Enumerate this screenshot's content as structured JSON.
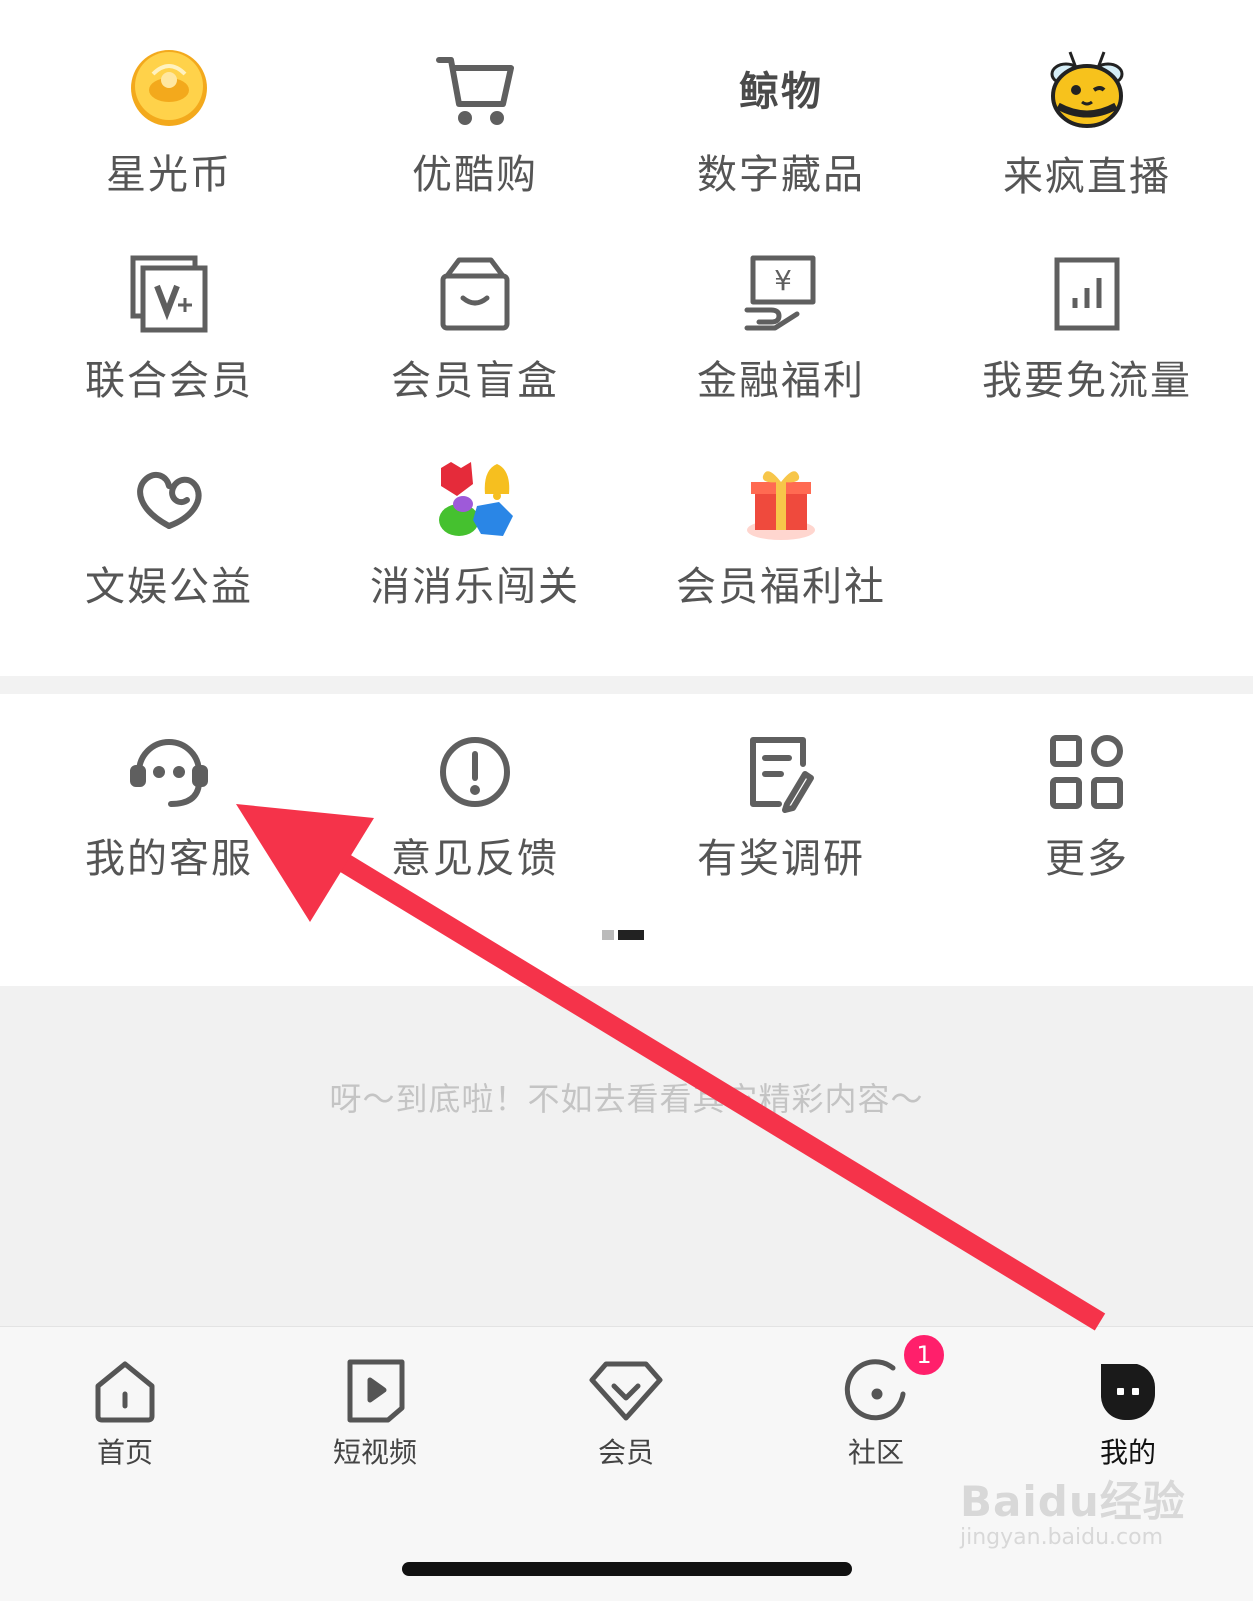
{
  "services": [
    {
      "label": "星光币",
      "icon": "star-coin-icon"
    },
    {
      "label": "优酷购",
      "icon": "cart-icon"
    },
    {
      "label": "数字藏品",
      "icon": "digital-collectibles-icon"
    },
    {
      "label": "来疯直播",
      "icon": "bee-icon"
    },
    {
      "label": "联合会员",
      "icon": "joint-membership-icon"
    },
    {
      "label": "会员盲盒",
      "icon": "blind-box-icon"
    },
    {
      "label": "金融福利",
      "icon": "finance-icon"
    },
    {
      "label": "我要免流量",
      "icon": "free-data-icon"
    },
    {
      "label": "文娱公益",
      "icon": "charity-heart-icon"
    },
    {
      "label": "消消乐闯关",
      "icon": "match-game-icon"
    },
    {
      "label": "会员福利社",
      "icon": "gift-box-icon"
    }
  ],
  "digital_logo_text": "鲸物",
  "tools": [
    {
      "label": "我的客服",
      "icon": "customer-service-icon"
    },
    {
      "label": "意见反馈",
      "icon": "feedback-icon"
    },
    {
      "label": "有奖调研",
      "icon": "survey-icon"
    },
    {
      "label": "更多",
      "icon": "more-grid-icon"
    }
  ],
  "pager": {
    "pages": 2,
    "active": 2
  },
  "end_message": "呀～到底啦！不如去看看其它精彩内容～",
  "tabbar": {
    "items": [
      {
        "label": "首页",
        "icon": "home-icon"
      },
      {
        "label": "短视频",
        "icon": "short-video-icon"
      },
      {
        "label": "会员",
        "icon": "vip-diamond-icon"
      },
      {
        "label": "社区",
        "icon": "community-icon"
      },
      {
        "label": "我的",
        "icon": "mine-icon"
      }
    ],
    "active_index": 4,
    "community_badge": "1"
  },
  "watermark": {
    "brand": "Baidu经验",
    "url": "jingyan.baidu.com"
  },
  "colors": {
    "arrow": "#f5334a",
    "badge": "#ff1f6b",
    "icon_gray": "#5f5f5f",
    "coin": "#f6b52a"
  }
}
